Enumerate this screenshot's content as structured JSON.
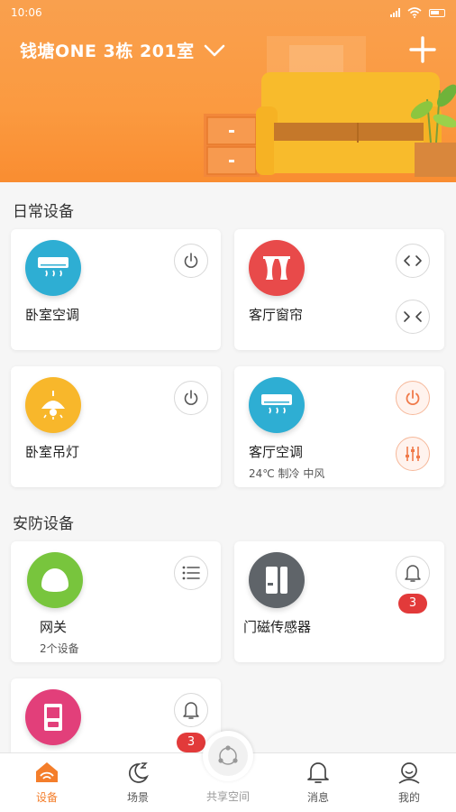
{
  "status_bar": {
    "time": "10:06"
  },
  "header": {
    "home_name": "钱塘ONE 3栋 201室"
  },
  "sections": {
    "daily": "日常设备",
    "security": "安防设备"
  },
  "devices": {
    "bedroom_ac": {
      "name": "卧室空调"
    },
    "living_curtain": {
      "name": "客厅窗帘"
    },
    "bedroom_lamp": {
      "name": "卧室吊灯"
    },
    "living_ac": {
      "name": "客厅空调",
      "status": "24℃ 制冷 中风"
    },
    "gateway": {
      "name": "网关",
      "sub": "2个设备"
    },
    "door_sensor": {
      "name": "门磁传感器",
      "alerts": "3"
    },
    "pink_device": {
      "name": "",
      "alerts": "3"
    }
  },
  "bottom_nav": {
    "devices": "设备",
    "scenes": "场景",
    "shared": "共享空间",
    "messages": "消息",
    "mine": "我的"
  },
  "colors": {
    "accent": "#f47e2b",
    "header_orange": "#fb9a40",
    "ac_blue": "#2eaed3",
    "curtain_red": "#e84a4a",
    "lamp_yellow": "#f8b72b",
    "gateway_green": "#78c53d",
    "sensor_gray": "#5f6469",
    "pink": "#e23f7a",
    "badge_red": "#e23a3a"
  }
}
